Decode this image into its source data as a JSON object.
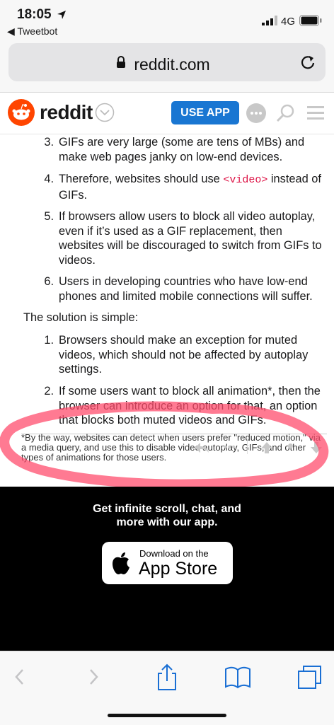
{
  "status_bar": {
    "time": "18:05",
    "back_app": "◀ Tweetbot",
    "network": "4G"
  },
  "browser": {
    "url": "reddit.com"
  },
  "reddit_header": {
    "logo_text": "reddit",
    "use_app_label": "USE APP"
  },
  "content": {
    "list1": [
      {
        "num": "3.",
        "text": "GIFs are very large (some are tens of MBs) and make web pages janky on low-end devices."
      },
      {
        "num": "4.",
        "text_before": "Therefore, websites should use ",
        "code": "<video>",
        "text_after": " instead of GIFs."
      },
      {
        "num": "5.",
        "text": "If browsers allow users to block all video autoplay, even if it’s used as a GIF replacement, then websites will be discouraged to switch from GIFs to videos."
      },
      {
        "num": "6.",
        "text": "Users in developing countries who have low-end phones and limited mobile connections will suffer."
      }
    ],
    "solution_heading": "The solution is simple:",
    "list2": [
      {
        "num": "1.",
        "text": "Browsers should make an exception for muted videos, which should not be affected by autoplay settings."
      },
      {
        "num": "2.",
        "text": "If some users want to block all animation*, then the browser can introduce an option for that, an option that blocks both muted videos and GIFs."
      }
    ],
    "footnote": "*By the way, websites can detect when users prefer \"reduced motion,\" via a media query, and use this to disable video autoplay, GIFs, and other types of animations for those users."
  },
  "promo": {
    "line1": "Get infinite scroll, chat, and",
    "line2": "more with our app.",
    "button_small": "Download on the",
    "button_big": "App Store"
  },
  "colors": {
    "reddit_orange": "#ff4500",
    "use_app_blue": "#1976d2",
    "ios_blue": "#1a6fd4",
    "annotation_red": "#ff4d6d"
  }
}
